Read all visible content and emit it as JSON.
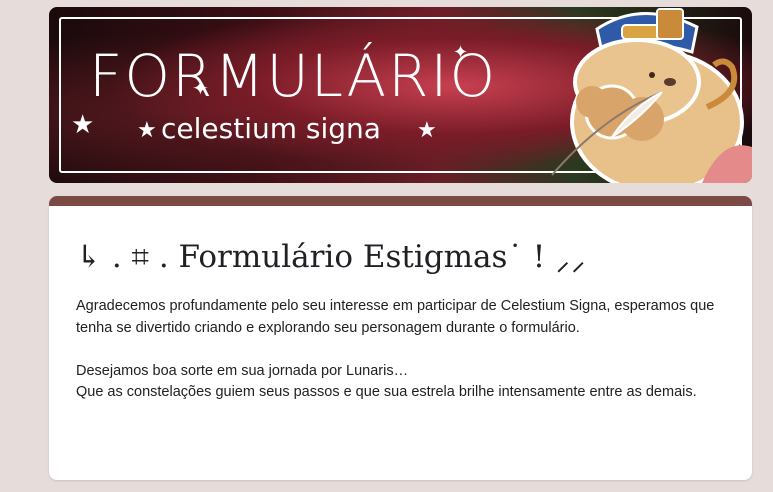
{
  "banner": {
    "title": "FORMULÁRIO",
    "subtitle": "celestium signa",
    "star_glyph": "★",
    "sparkle_glyph": "✦",
    "mascot_icon": "capybara-mascot-icon",
    "colors": {
      "frame": "#ffffff",
      "bg_dark": "#1a0a0c",
      "bg_red": "#c84050"
    }
  },
  "form": {
    "accent_color": "#7b4a45",
    "title": "↳ . ⌗ . Formulário Estigmas˙ ! ⸝⸝",
    "description": {
      "paragraph1": "Agradecemos profundamente pelo seu interesse em participar de Celestium Signa, esperamos que tenha se divertido criando e explorando seu personagem durante o formulário.",
      "line2": "Desejamos boa sorte em sua jornada por Lunaris…",
      "line3": "Que as constelações guiem seus passos e que sua estrela brilhe intensamente entre as demais."
    }
  }
}
